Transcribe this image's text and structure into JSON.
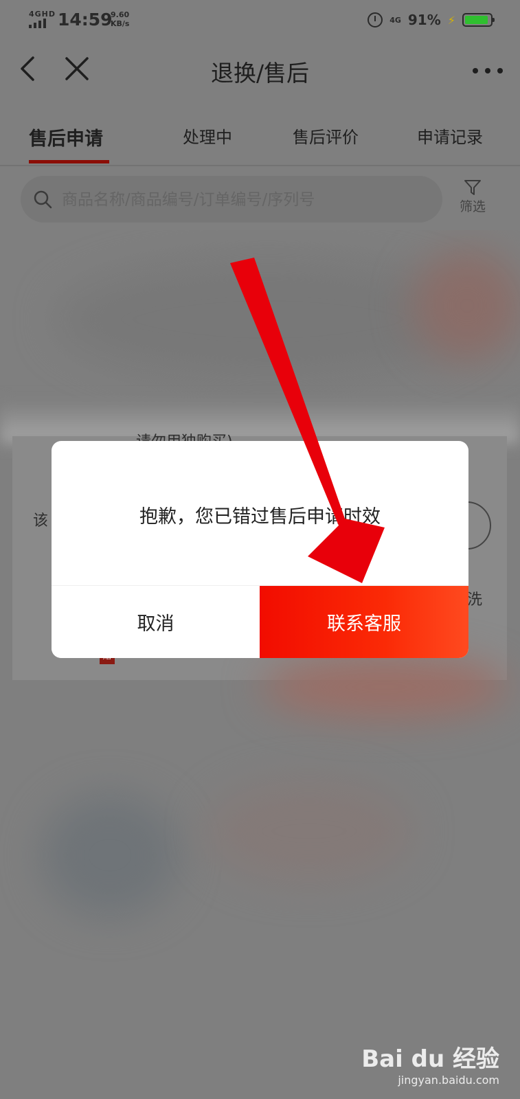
{
  "status_bar": {
    "network": "4GHD",
    "time": "14:59",
    "speed_value": "9.60",
    "speed_unit": "KB/s",
    "network_right": "4G",
    "battery_percent": "91%",
    "battery_level": 0.91,
    "battery_color": "#2fbf2f"
  },
  "header": {
    "title": "退换/售后",
    "icons": [
      "back-icon",
      "close-icon",
      "more-icon"
    ]
  },
  "tabs": [
    {
      "label": "售后申请",
      "active": true
    },
    {
      "label": "处理中",
      "active": false
    },
    {
      "label": "售后评价",
      "active": false
    },
    {
      "label": "申请记录",
      "active": false
    }
  ],
  "search": {
    "placeholder": "商品名称/商品编号/订单编号/序列号"
  },
  "filter": {
    "label": "筛选"
  },
  "background_fragments": {
    "top_line": "请勿用独购买)",
    "left_fragment": "该",
    "right_fragment": "洗",
    "badge": "赠"
  },
  "dialog": {
    "message": "抱歉，您已错过售后申请时效",
    "cancel_label": "取消",
    "contact_label": "联系客服",
    "accent_color": "#f20c00"
  },
  "annotation": {
    "arrow_color": "#e8000a"
  },
  "watermark": {
    "brand": "Bai du 经验",
    "url": "jingyan.baidu.com"
  }
}
